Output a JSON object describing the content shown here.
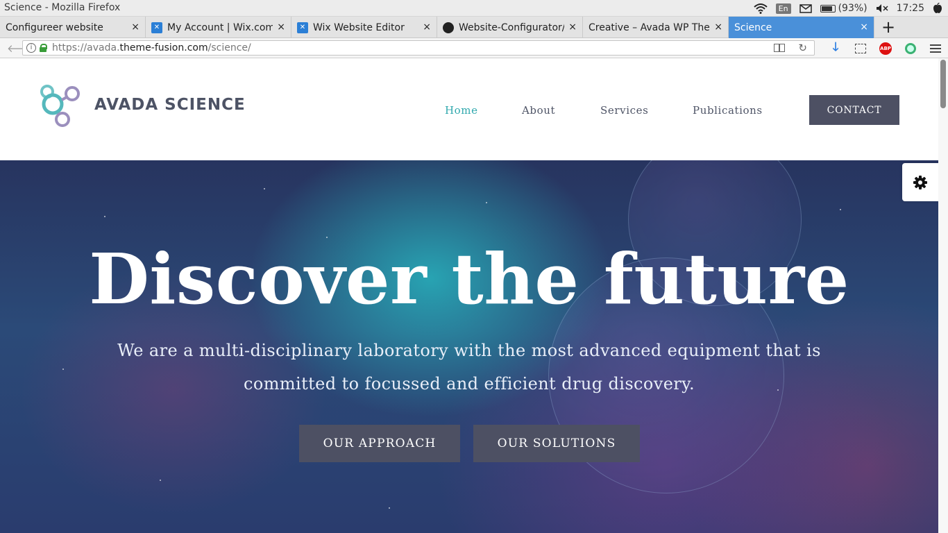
{
  "os": {
    "window_title": "Science - Mozilla Firefox",
    "keyboard_layout": "En",
    "battery": "(93%)",
    "clock": "17:25"
  },
  "browser": {
    "tabs": [
      {
        "label": "Configureer website",
        "icon": "none",
        "active": false
      },
      {
        "label": "My Account | Wix.com",
        "icon": "wix-icon",
        "active": false
      },
      {
        "label": "Wix Website Editor",
        "icon": "wix-icon",
        "active": false
      },
      {
        "label": "Website-Configurator/s",
        "icon": "github-icon",
        "active": false
      },
      {
        "label": "Creative – Avada WP Ther",
        "icon": "none",
        "active": false
      },
      {
        "label": "Science",
        "icon": "none",
        "active": true
      }
    ],
    "close_glyph": "×",
    "new_tab_glyph": "+",
    "url_prefix": "https://avada.",
    "url_domain": "theme-fusion.com",
    "url_path": "/science/"
  },
  "site": {
    "brand": "AVADA SCIENCE",
    "menu": [
      "Home",
      "About",
      "Services",
      "Publications"
    ],
    "active_menu": "Home",
    "contact": "CONTACT"
  },
  "hero": {
    "title": "Discover the future",
    "subtitle": "We are a multi-disciplinary laboratory with the most advanced equipment that is committed to focussed and efficient drug discovery.",
    "buttons": [
      "OUR APPROACH",
      "OUR SOLUTIONS"
    ]
  },
  "colors": {
    "accent": "#2fa8ad",
    "button_bg": "#4d5063",
    "text_dark": "#4d5365",
    "active_tab": "#4a90d9"
  }
}
